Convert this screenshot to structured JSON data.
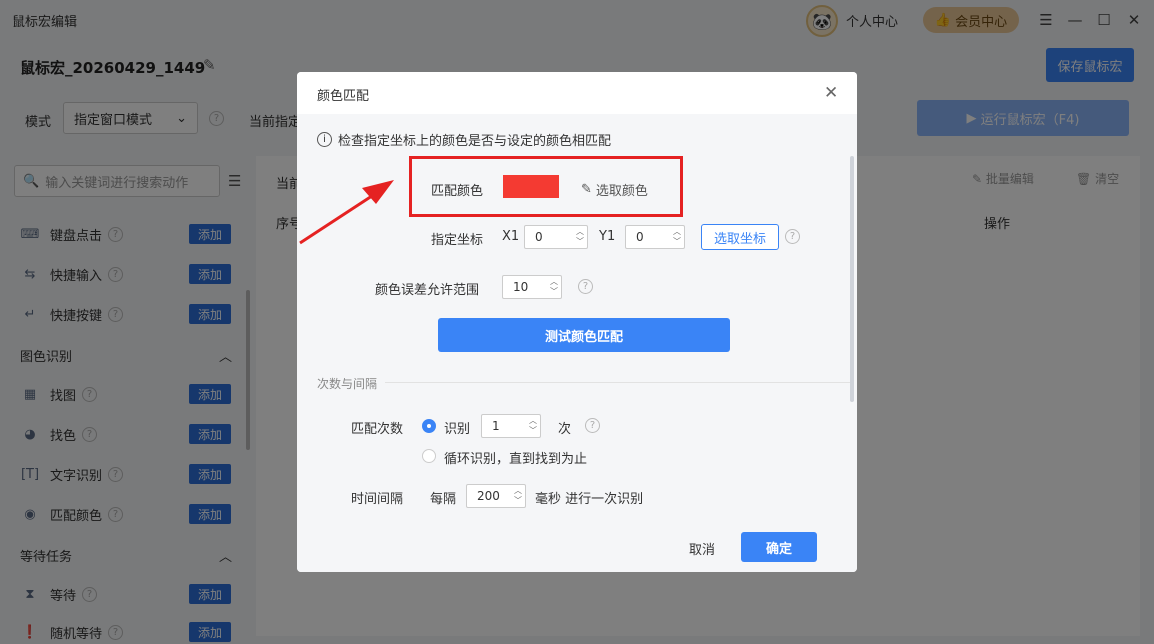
{
  "window": {
    "title": "鼠标宏编辑",
    "user_center": "个人中心",
    "vip_center": "会员中心"
  },
  "header": {
    "macro_name": "鼠标宏_20260429_1449",
    "save_label": "保存鼠标宏"
  },
  "toolbar": {
    "mode_label": "模式",
    "mode_value": "指定窗口模式",
    "current_label": "当前指定",
    "run_label": "运行鼠标宏（F4)"
  },
  "sidebar": {
    "search_placeholder": "输入关键词进行搜索动作",
    "add_label": "添加",
    "items": [
      {
        "label": "键盘点击",
        "icon": "keyboard-icon"
      },
      {
        "label": "快捷输入",
        "icon": "quick-input-icon"
      },
      {
        "label": "快捷按键",
        "icon": "enter-key-icon"
      }
    ],
    "group1": "图色识别",
    "group1_items": [
      {
        "label": "找图",
        "icon": "image-icon"
      },
      {
        "label": "找色",
        "icon": "palette-icon"
      },
      {
        "label": "文字识别",
        "icon": "text-recognize-icon"
      },
      {
        "label": "匹配颜色",
        "icon": "color-match-icon"
      }
    ],
    "group2": "等待任务",
    "group2_items": [
      {
        "label": "等待",
        "icon": "hourglass-icon"
      },
      {
        "label": "随机等待",
        "icon": "random-wait-icon"
      }
    ]
  },
  "main": {
    "crumb": "当前",
    "seq": "序号",
    "op": "操作",
    "batch_edit": "批量编辑",
    "clear": "清空"
  },
  "dialog": {
    "title": "颜色匹配",
    "info": "检查指定坐标上的颜色是否与设定的颜色相匹配",
    "match_color_label": "匹配颜色",
    "match_color": "#f43a32",
    "pick_color_label": "选取颜色",
    "coord_label": "指定坐标",
    "x_label": "X1",
    "x_value": "0",
    "y_label": "Y1",
    "y_value": "0",
    "pick_coord_label": "选取坐标",
    "tolerance_label": "颜色误差允许范围",
    "tolerance_value": "10",
    "test_label": "测试颜色匹配",
    "section_label": "次数与间隔",
    "count_label": "匹配次数",
    "recognize_label": "识别",
    "count_value": "1",
    "count_unit": "次",
    "loop_label": "循环识别，直到找到为止",
    "interval_label": "时间间隔",
    "every_label": "每隔",
    "interval_value": "200",
    "ms_label": "毫秒 进行一次识别",
    "cancel_label": "取消",
    "ok_label": "确定"
  },
  "colors": {
    "accent": "#3a84f6",
    "highlight_border": "#e52222",
    "swatch": "#f43a32"
  }
}
